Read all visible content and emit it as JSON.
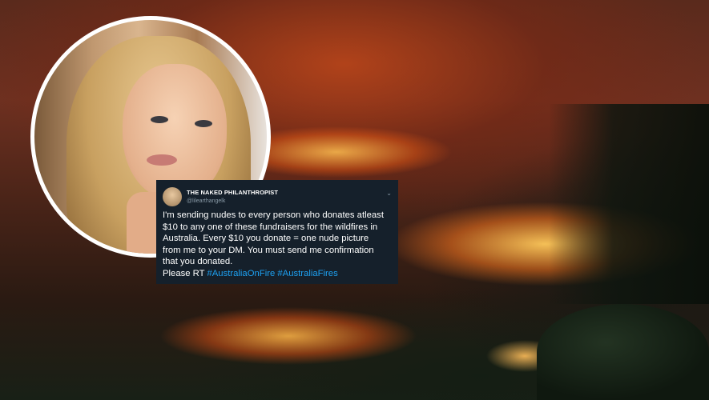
{
  "tweet": {
    "display_name": "THE NAKED PHILANTHROPIST",
    "handle": "@lilearthangelk",
    "lines": [
      "I'm sending nudes to every person who donates atleast",
      "$10 to any one of these fundraisers for the wildfires in",
      "Australia. Every $10 you donate = one nude picture",
      "from me to your DM. You must send me confirmation",
      "that you donated."
    ],
    "cta": "Please RT",
    "hashtags": [
      "#AustraliaOnFire",
      "#AustraliaFires"
    ],
    "menu_icon": "chevron-down-icon"
  },
  "colors": {
    "tweet_bg": "#15202b",
    "hashtag": "#1da1f2",
    "handle": "#8899a6"
  }
}
